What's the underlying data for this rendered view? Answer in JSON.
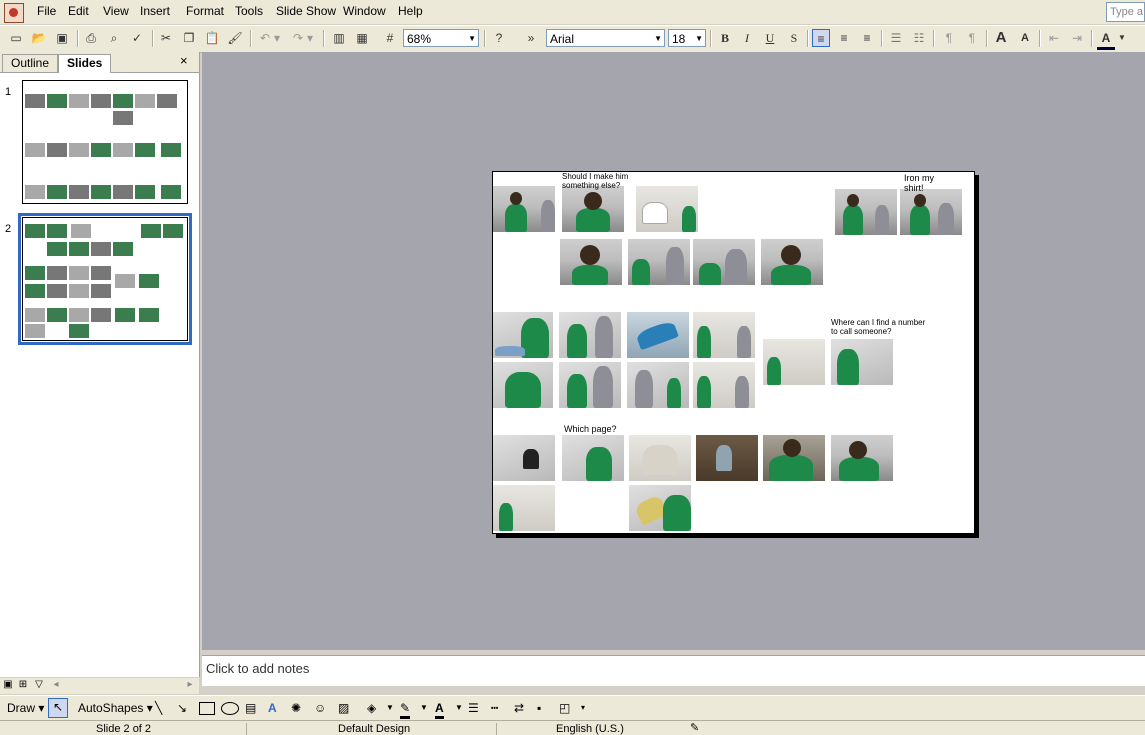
{
  "menubar": {
    "items": [
      "File",
      "Edit",
      "View",
      "Insert",
      "Format",
      "Tools",
      "Slide Show",
      "Window",
      "Help"
    ],
    "help_placeholder": "Type a"
  },
  "toolbar": {
    "zoom": "68%",
    "font_name": "Arial",
    "font_size": "18",
    "icons": [
      "new-icon",
      "open-icon",
      "save-icon",
      "print-icon",
      "print-preview-icon",
      "spelling-icon",
      "cut-icon",
      "copy-icon",
      "paste-icon",
      "format-painter-icon",
      "undo-icon",
      "redo-icon",
      "chart-icon",
      "table-icon",
      "grid-icon",
      "help-icon",
      "bold-icon",
      "italic-icon",
      "underline-icon",
      "shadow-icon",
      "align-left-icon",
      "center-icon",
      "align-right-icon",
      "numbering-icon",
      "bullets-icon",
      "ltr-icon",
      "rtl-icon",
      "increase-font-icon",
      "decrease-font-icon",
      "decrease-indent-icon",
      "increase-indent-icon",
      "font-color-icon"
    ]
  },
  "left_pane": {
    "tabs": [
      "Outline",
      "Slides"
    ],
    "active_tab": "Slides",
    "close_label": "×",
    "slides": [
      {
        "number": "1",
        "selected": false
      },
      {
        "number": "2",
        "selected": true
      }
    ]
  },
  "slide": {
    "captions": {
      "c1": "Should I make him something else?",
      "c2": "Iron my shirt!",
      "c3": "Where can I find a number to call someone?",
      "c4": "Which page?"
    }
  },
  "notes": {
    "placeholder": "Click to add notes"
  },
  "drawbar": {
    "draw_label": "Draw",
    "autoshapes_label": "AutoShapes"
  },
  "statusbar": {
    "slide_info": "Slide 2 of 2",
    "design": "Default Design",
    "language": "English (U.S.)"
  },
  "colors": {
    "selection": "#316ac5",
    "workspace": "#a5a5ad",
    "shirt_green": "#1e8a4a"
  }
}
